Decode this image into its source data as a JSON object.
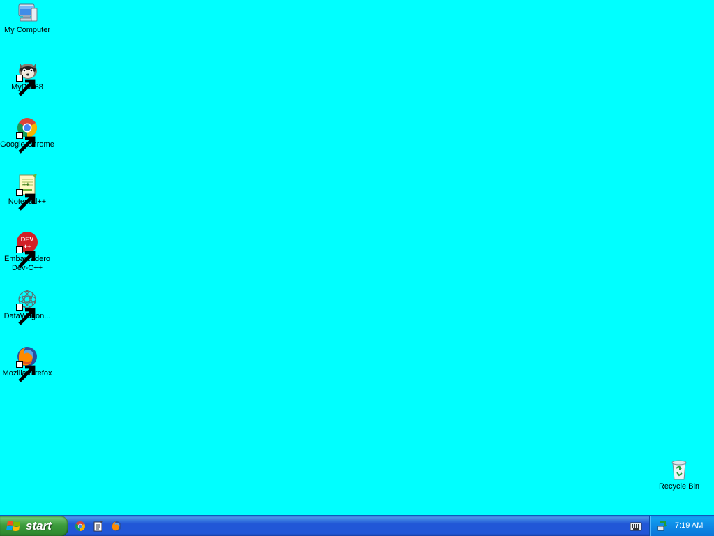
{
  "desktop": {
    "background_color": "#00ffff",
    "icons": [
      {
        "label": "My Computer",
        "icon": "my-computer-icon",
        "shortcut": false
      },
      {
        "label": "MyPal 68",
        "icon": "raccoon-icon",
        "shortcut": true
      },
      {
        "label": "Google Chrome",
        "icon": "chrome-icon",
        "shortcut": true
      },
      {
        "label": "Notepad++",
        "icon": "notepad-plus-plus-icon",
        "shortcut": true
      },
      {
        "label": "Embarcadero Dev-C++",
        "icon": "dev-cpp-icon",
        "shortcut": true,
        "badge": "DEV ++"
      },
      {
        "label": "DataWagon...",
        "icon": "datawagon-icon",
        "shortcut": true
      },
      {
        "label": "Mozilla Firefox",
        "icon": "firefox-icon",
        "shortcut": true
      }
    ],
    "recycle_bin": {
      "label": "Recycle Bin",
      "icon": "recycle-bin-icon"
    }
  },
  "taskbar": {
    "start_label": "start",
    "quick_launch": [
      {
        "icon": "chrome-icon"
      },
      {
        "icon": "notepad-icon"
      },
      {
        "icon": "firefox-icon"
      }
    ],
    "clock": "7:19 AM",
    "colors": {
      "taskbar": "#2157d7",
      "start": "#3c9b3c",
      "tray": "#0d8ae6"
    }
  }
}
